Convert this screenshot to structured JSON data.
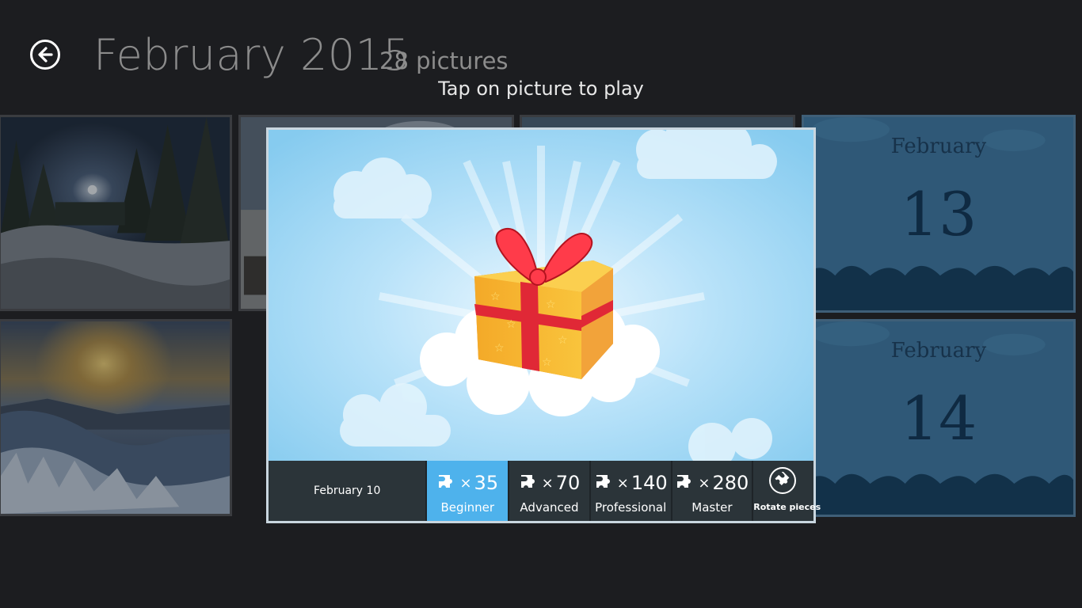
{
  "header": {
    "back_icon": "back-arrow-icon",
    "title": "February 2015",
    "count": "28 pictures",
    "hint": "Tap on picture to play"
  },
  "tiles": {
    "cal_13": {
      "month": "February",
      "day": "13"
    },
    "cal_14": {
      "month": "February",
      "day": "14"
    }
  },
  "popup": {
    "picture_name": "February 10",
    "levels": [
      {
        "count": "35",
        "label": "Beginner",
        "active": true
      },
      {
        "count": "70",
        "label": "Advanced",
        "active": false
      },
      {
        "count": "140",
        "label": "Professional",
        "active": false
      },
      {
        "count": "280",
        "label": "Master",
        "active": false
      }
    ],
    "times": "×",
    "rotate_label": "Rotate pieces",
    "puzzle_icon": "puzzle-piece-icon",
    "rotate_icon": "rotate-puzzle-icon"
  },
  "colors": {
    "background": "#1c1d20",
    "accent": "#4eb2ec",
    "bar": "#2b3439",
    "calendar_tile": "#2e5676"
  }
}
